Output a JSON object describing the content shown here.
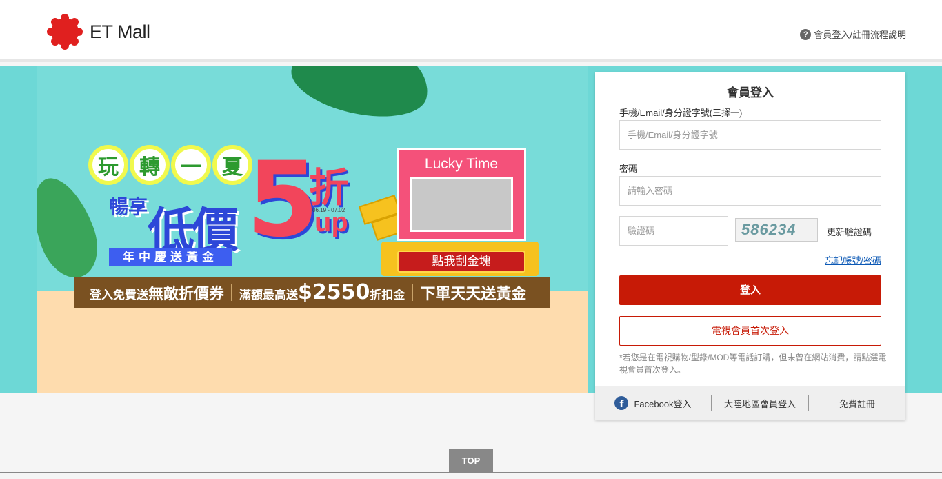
{
  "header": {
    "logo_badge": "東森購物",
    "logo_text": "ET Mall",
    "help_link": "會員登入/註冊流程說明"
  },
  "banner": {
    "headline_play": [
      "玩",
      "轉",
      "一",
      "夏"
    ],
    "headline_low_price": "低價",
    "headline_enjoy": "暢享",
    "discount_number": "5",
    "discount_unit": "折",
    "discount_up": "up",
    "date_range": "06.19 - 07.02",
    "ribbon": "年中慶送黃金",
    "lucky_title": "Lucky Time",
    "scratch_button": "點我刮金塊",
    "strip_1_prefix": "登入免費送",
    "strip_1_bold": "無敵折價券",
    "strip_2_prefix": "滿額最高送",
    "strip_2_amount": "$2550",
    "strip_2_suffix": "折扣金",
    "strip_3": "下單天天送黃金"
  },
  "login": {
    "title": "會員登入",
    "account_label": "手機/Email/身分證字號(三擇一)",
    "account_placeholder": "手機/Email/身分證字號",
    "password_label": "密碼",
    "password_placeholder": "請輸入密碼",
    "captcha_placeholder": "驗證碼",
    "captcha_text": "586234",
    "refresh_captcha": "更新驗證碼",
    "forgot": "忘記帳號/密碼",
    "login_button": "登入",
    "tv_member_button": "電視會員首次登入",
    "note": "*若您是在電視購物/型錄/MOD等電話訂購，但未曾在網站消費，請點選電視會員首次登入。",
    "footer": {
      "facebook": "Facebook登入",
      "mainland": "大陸地區會員登入",
      "register": "免費註冊"
    }
  },
  "top_button": "TOP",
  "colors": {
    "brand_red": "#c71a06",
    "banner_teal": "#6dd8d6",
    "facebook_blue": "#2f5c99"
  }
}
